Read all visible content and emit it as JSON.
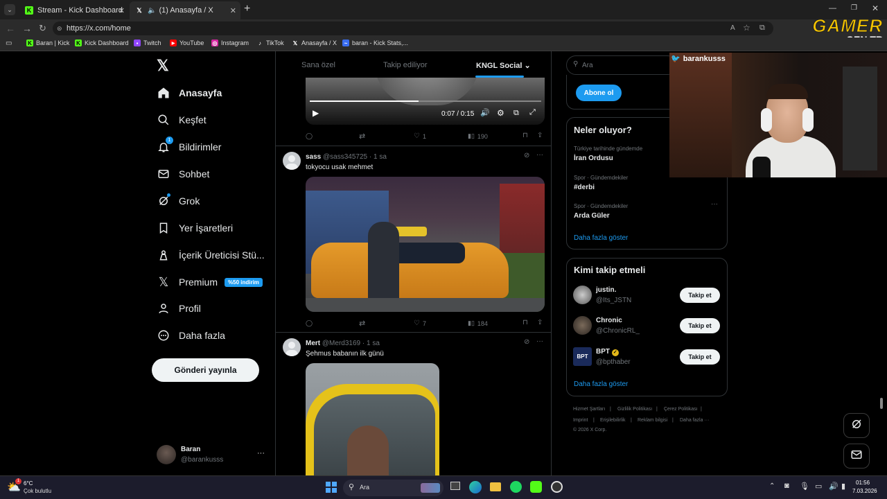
{
  "browser": {
    "tabs": [
      {
        "title": "Stream - Kick Dashboard",
        "icon": "kick-icon"
      },
      {
        "title": "(1) Anasayfa / X",
        "icon": "x-logo-icon"
      }
    ],
    "url": "https://x.com/home",
    "bookmarks": [
      {
        "label": "Baran | Kick",
        "icon": "kick-icon"
      },
      {
        "label": "Kick Dashboard",
        "icon": "kick-icon"
      },
      {
        "label": "Twitch",
        "icon": "twitch-icon"
      },
      {
        "label": "YouTube",
        "icon": "youtube-icon"
      },
      {
        "label": "Instagram",
        "icon": "instagram-icon"
      },
      {
        "label": "TikTok",
        "icon": "tiktok-icon"
      },
      {
        "label": "Anasayfa / X",
        "icon": "x-logo-icon"
      },
      {
        "label": "baran - Kick Stats,...",
        "icon": "stats-icon"
      }
    ]
  },
  "watermark": {
    "line1": "GAMER",
    "line2": "GEN.TR"
  },
  "webcam": {
    "handle": "barankusss"
  },
  "nav": {
    "items": [
      {
        "label": "Anasayfa",
        "icon": "home-icon"
      },
      {
        "label": "Keşfet",
        "icon": "search-icon"
      },
      {
        "label": "Bildirimler",
        "icon": "bell-icon",
        "badge": "1"
      },
      {
        "label": "Sohbet",
        "icon": "mail-icon"
      },
      {
        "label": "Grok",
        "icon": "grok-icon"
      },
      {
        "label": "Yer İşaretleri",
        "icon": "bookmark-icon"
      },
      {
        "label": "İçerik Üreticisi Stü...",
        "icon": "creator-icon"
      },
      {
        "label": "Premium",
        "icon": "x-logo-icon",
        "badge": "%50 indirim"
      },
      {
        "label": "Profil",
        "icon": "person-icon"
      },
      {
        "label": "Daha fazla",
        "icon": "more-circle-icon"
      }
    ],
    "post_label": "Gönderi yayınla",
    "account": {
      "name": "Baran",
      "handle": "@barankusss"
    }
  },
  "feed": {
    "tabs": [
      "Sana özel",
      "Takip ediliyor",
      "KNGL Social"
    ],
    "video_time": "0:07 / 0:15",
    "video_progress": 0.47,
    "post0": {
      "likes": "1",
      "views": "190"
    },
    "posts": [
      {
        "name": "sass",
        "handle": "@sass345725",
        "time": "1 sa",
        "text": "tokyocu usak mehmet",
        "likes": "7",
        "views": "184"
      },
      {
        "name": "Mert",
        "handle": "@Merd3169",
        "time": "1 sa",
        "text": "Şehmus babanın ilk günü"
      }
    ]
  },
  "right": {
    "search_placeholder": "Ara",
    "subscribe_label": "Abone ol",
    "trends_title": "Neler oluyor?",
    "trends": [
      {
        "category": "Türkiye tarihinde gündemde",
        "name": "İran Ordusu"
      },
      {
        "category": "Spor · Gündemdekiler",
        "name": "#derbi"
      },
      {
        "category": "Spor · Gündemdekiler",
        "name": "Arda Güler"
      }
    ],
    "show_more": "Daha fazla göster",
    "who_title": "Kimi takip etmeli",
    "who": [
      {
        "name": "justin.",
        "handle": "@Its_JSTN"
      },
      {
        "name": "Chronic",
        "handle": "@ChronicRL_"
      },
      {
        "name": "BPT",
        "handle": "@bpthaber",
        "verified": true
      }
    ],
    "follow_label": "Takip et",
    "footer": [
      "Hizmet Şartları",
      "Gizlilik Politikası",
      "Çerez Politikası",
      "Imprint",
      "Erişilebilirlik",
      "Reklam bilgisi",
      "Daha fazla ···",
      "© 2026 X Corp."
    ]
  },
  "taskbar": {
    "weather_temp": "6°C",
    "weather_desc": "Çok bulutlu",
    "search": "Ara",
    "time": "01:56",
    "date": "7.03.2026"
  },
  "colors": {
    "accent": "#1d9bf0",
    "kick_green": "#53fc18",
    "watermark_yellow": "#f5c400"
  }
}
